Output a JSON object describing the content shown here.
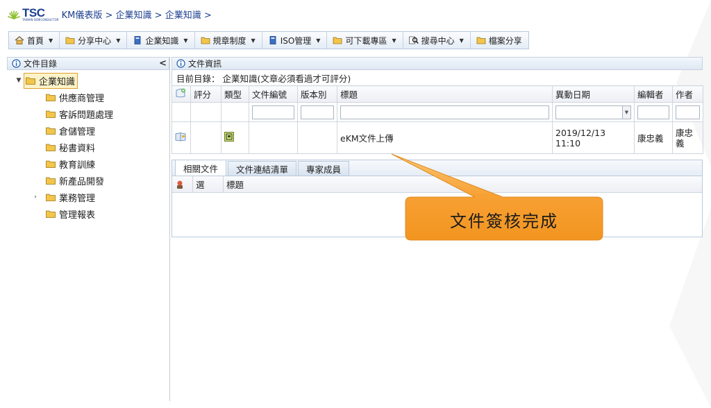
{
  "header": {
    "logo_text": "TSC",
    "logo_sub": "TAIWAN SEMICONDUCTOR",
    "breadcrumb": [
      "KM儀表版",
      "企業知識",
      "企業知識"
    ],
    "separator": " > ",
    "trailing": " >"
  },
  "toolbar": {
    "items": [
      {
        "label": "首頁",
        "icon": "home-icon"
      },
      {
        "label": "分享中心",
        "icon": "folder-icon"
      },
      {
        "label": "企業知識",
        "icon": "book-icon"
      },
      {
        "label": "規章制度",
        "icon": "folder-icon"
      },
      {
        "label": "ISO管理",
        "icon": "book-icon"
      },
      {
        "label": "可下載專區",
        "icon": "folder-icon"
      },
      {
        "label": "搜尋中心",
        "icon": "search-icon"
      },
      {
        "label": "檔案分享",
        "icon": "folder-icon"
      }
    ]
  },
  "left_panel": {
    "title": "文件目錄",
    "collapse_glyph": "<",
    "root": "企業知識",
    "children": [
      "供應商管理",
      "客訴問題處理",
      "倉儲管理",
      "秘書資料",
      "教育訓練",
      "新產品開發",
      "業務管理",
      "管理報表"
    ]
  },
  "right_panel": {
    "title": "文件資訊",
    "current_dir_label": "目前目錄：",
    "current_dir": "企業知識(文章必須看過才可評分)",
    "columns": [
      "評分",
      "類型",
      "文件編號",
      "版本別",
      "標題",
      "異動日期",
      "編輯者",
      "作者"
    ],
    "rows": [
      {
        "rating": "",
        "doc_no": "",
        "version": "",
        "title": "eKM文件上傳",
        "date": "2019/12/13 11:10",
        "editor": "康忠義",
        "author": "康忠義"
      }
    ],
    "tabs": [
      "相關文件",
      "文件連結清單",
      "專家成員"
    ],
    "sub_columns": [
      "選",
      "標題"
    ]
  },
  "callout": {
    "text": "文件簽核完成",
    "color": "#f7a033"
  }
}
